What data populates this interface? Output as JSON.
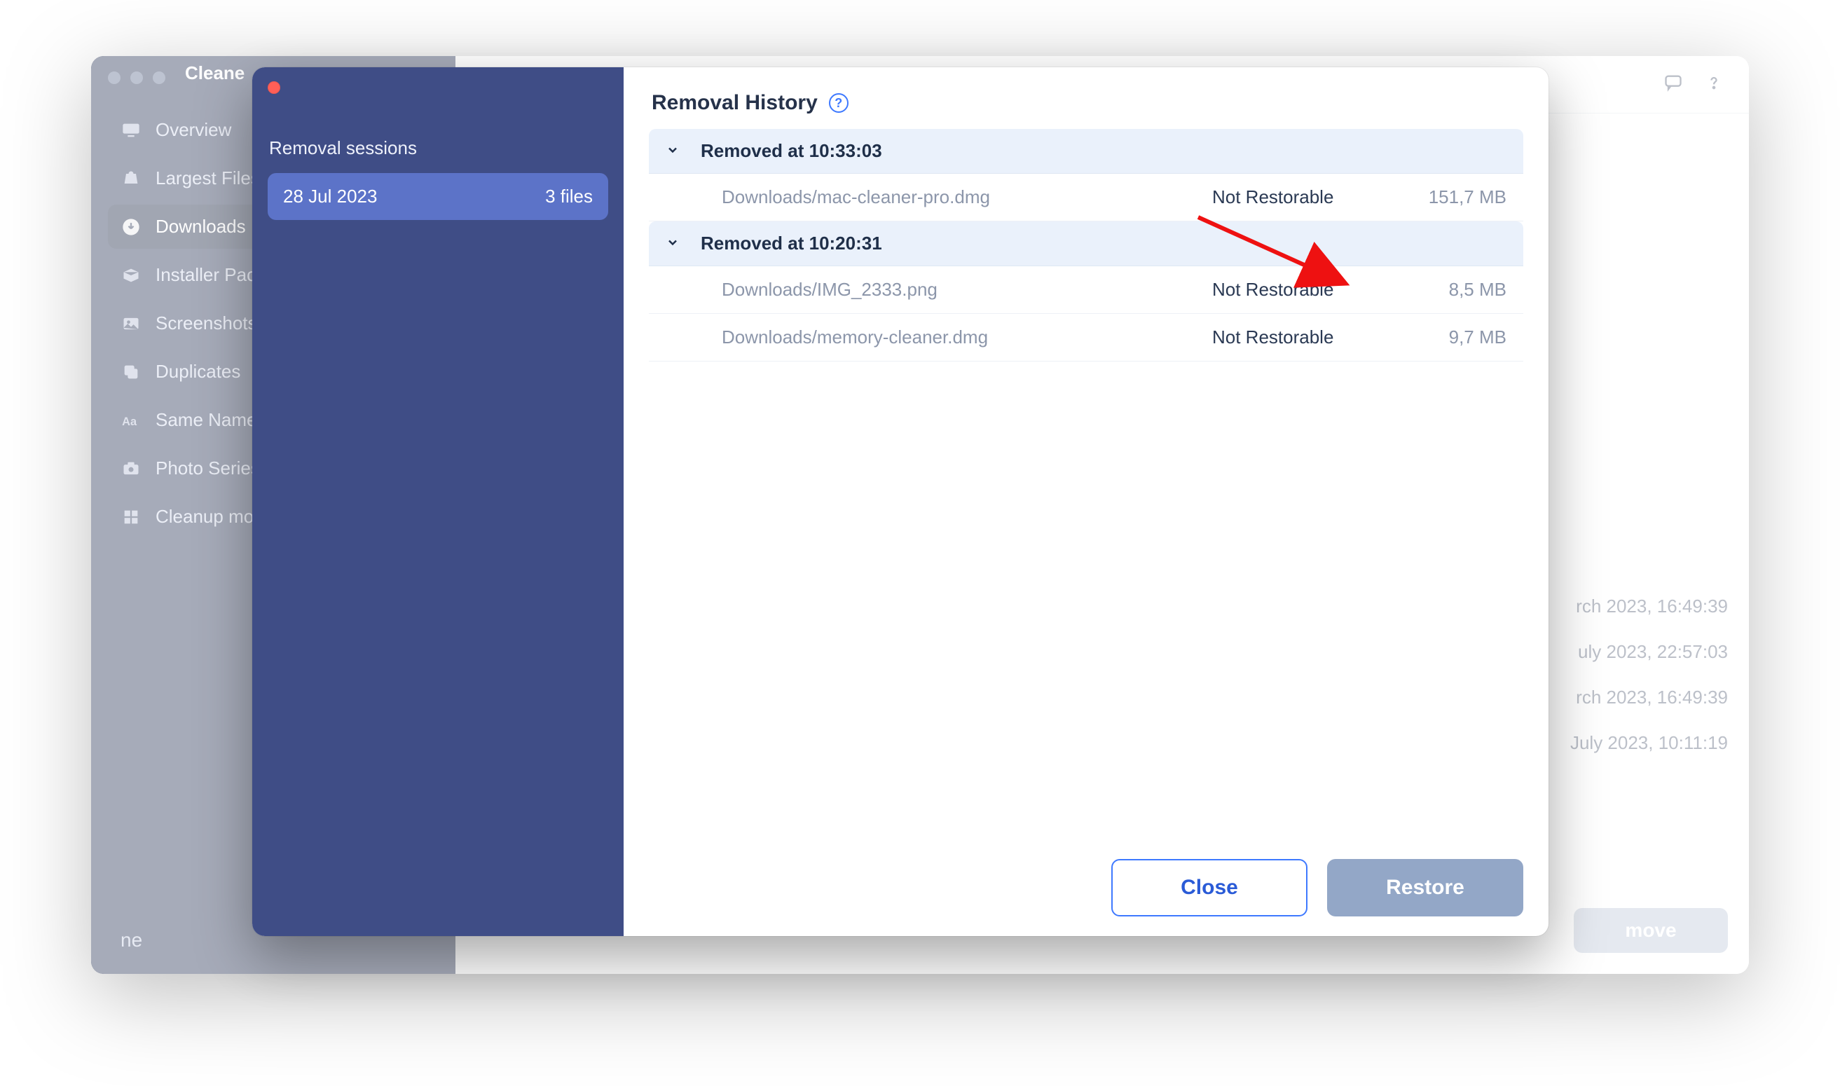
{
  "app": {
    "title": "Cleane"
  },
  "sidebar": {
    "items": [
      {
        "label": "Overview"
      },
      {
        "label": "Largest Files"
      },
      {
        "label": "Downloads"
      },
      {
        "label": "Installer Pack"
      },
      {
        "label": "Screenshots"
      },
      {
        "label": "Duplicates"
      },
      {
        "label": "Same Name"
      },
      {
        "label": "Photo Series"
      },
      {
        "label": "Cleanup mo"
      }
    ],
    "bottom": "ne"
  },
  "back": {
    "timestamps": [
      "rch 2023, 16:49:39",
      "uly 2023, 22:57:03",
      "rch 2023, 16:49:39",
      "July 2023, 10:11:19"
    ],
    "remove_label": "move"
  },
  "modal": {
    "title": "Removal History",
    "sessions_title": "Removal sessions",
    "session": {
      "date": "28 Jul 2023",
      "count": "3 files"
    },
    "groups": [
      {
        "label": "Removed at 10:33:03",
        "rows": [
          {
            "path": "Downloads/mac-cleaner-pro.dmg",
            "status": "Not Restorable",
            "size": "151,7 MB"
          }
        ]
      },
      {
        "label": "Removed at 10:20:31",
        "rows": [
          {
            "path": "Downloads/IMG_2333.png",
            "status": "Not Restorable",
            "size": "8,5 MB"
          },
          {
            "path": "Downloads/memory-cleaner.dmg",
            "status": "Not Restorable",
            "size": "9,7 MB"
          }
        ]
      }
    ],
    "close_label": "Close",
    "restore_label": "Restore"
  }
}
